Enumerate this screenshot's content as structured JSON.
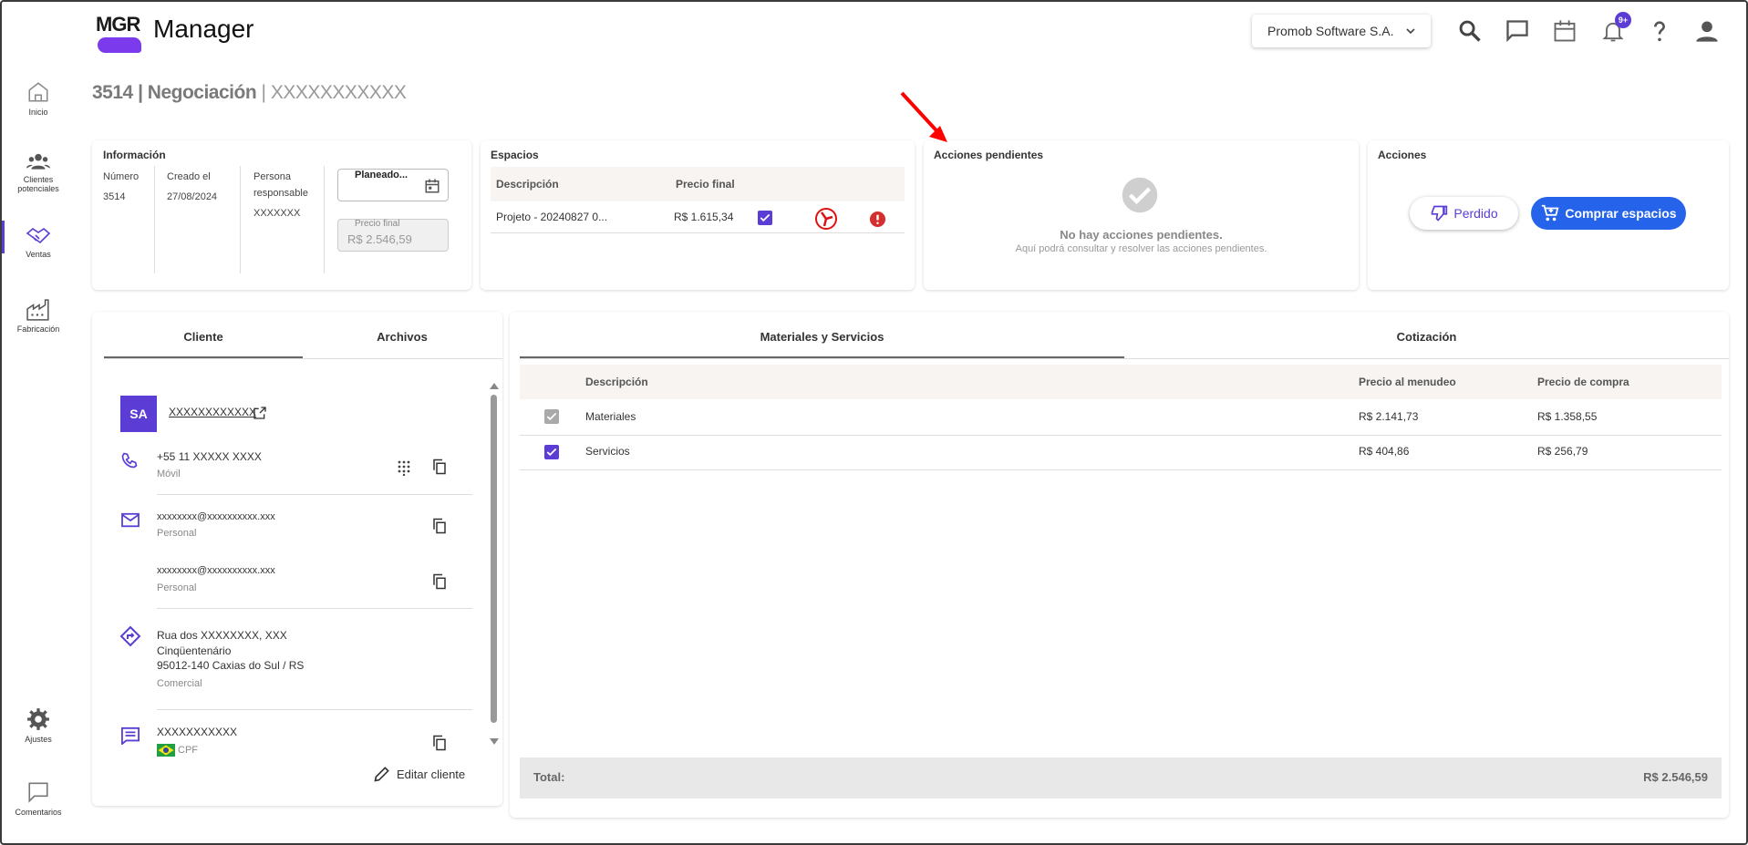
{
  "app": {
    "logo_text": "MGR",
    "title": "Manager"
  },
  "header": {
    "company": "Promob Software S.A.",
    "notifications_badge": "9+"
  },
  "sidebar": {
    "items": [
      {
        "label": "Inicio"
      },
      {
        "label": "Clientes potenciales"
      },
      {
        "label": "Ventas"
      },
      {
        "label": "Fabricación"
      },
      {
        "label": "Ajustes"
      },
      {
        "label": "Comentarios"
      }
    ]
  },
  "page": {
    "number": "3514",
    "separator": "|",
    "stage": "Negociación",
    "name": "XXXXXXXXXXX"
  },
  "info": {
    "title": "Información",
    "numero_label": "Número",
    "numero_value": "3514",
    "creado_label": "Creado el",
    "creado_value": "27/08/2024",
    "persona_label": "Persona responsable",
    "persona_value": "XXXXXXX",
    "status_label": "Planeado...",
    "precio_label": "Precio final",
    "precio_value": "R$ 2.546,59"
  },
  "espacios": {
    "title": "Espacios",
    "col_desc": "Descripción",
    "col_price": "Precio final",
    "rows": [
      {
        "desc": "Projeto - 20240827 0...",
        "price": "R$ 1.615,34"
      }
    ]
  },
  "pendientes": {
    "title": "Acciones pendientes",
    "empty_title": "No hay acciones pendientes.",
    "empty_sub": "Aquí podrá consultar y resolver las acciones pendientes."
  },
  "acciones": {
    "title": "Acciones",
    "lost": "Perdido",
    "buy": "Comprar espacios"
  },
  "left_tabs": {
    "cliente": "Cliente",
    "archivos": "Archivos"
  },
  "client": {
    "initials": "SA",
    "name": "XXXXXXXXXXXX",
    "phone": "+55 11 XXXXX XXXX",
    "phone_type": "Móvil",
    "email1": "xxxxxxxx@xxxxxxxxxx.xxx",
    "email1_type": "Personal",
    "email2": "xxxxxxxx@xxxxxxxxxx.xxx",
    "email2_type": "Personal",
    "addr1": "Rua dos XXXXXXXX, XXX",
    "addr2": "Cinqüentenário",
    "addr3": "95012-140 Caxias do Sul / RS",
    "addr_type": "Comercial",
    "doc": "XXXXXXXXXXX",
    "doc_type": "CPF",
    "edit": "Editar cliente"
  },
  "right_tabs": {
    "materiales": "Materiales y Servicios",
    "cotizacion": "Cotización"
  },
  "materials": {
    "col_desc": "Descripción",
    "col_retail": "Precio al menudeo",
    "col_purchase": "Precio de compra",
    "rows": [
      {
        "desc": "Materiales",
        "retail": "R$ 2.141,73",
        "purchase": "R$ 1.358,55"
      },
      {
        "desc": "Servicios",
        "retail": "R$ 404,86",
        "purchase": "R$ 256,79"
      }
    ],
    "total_label": "Total:",
    "total_value": "R$ 2.546,59"
  },
  "colors": {
    "accent": "#5b3dd6",
    "primary_button": "#2563eb",
    "annotation_arrow": "#ff0000"
  }
}
